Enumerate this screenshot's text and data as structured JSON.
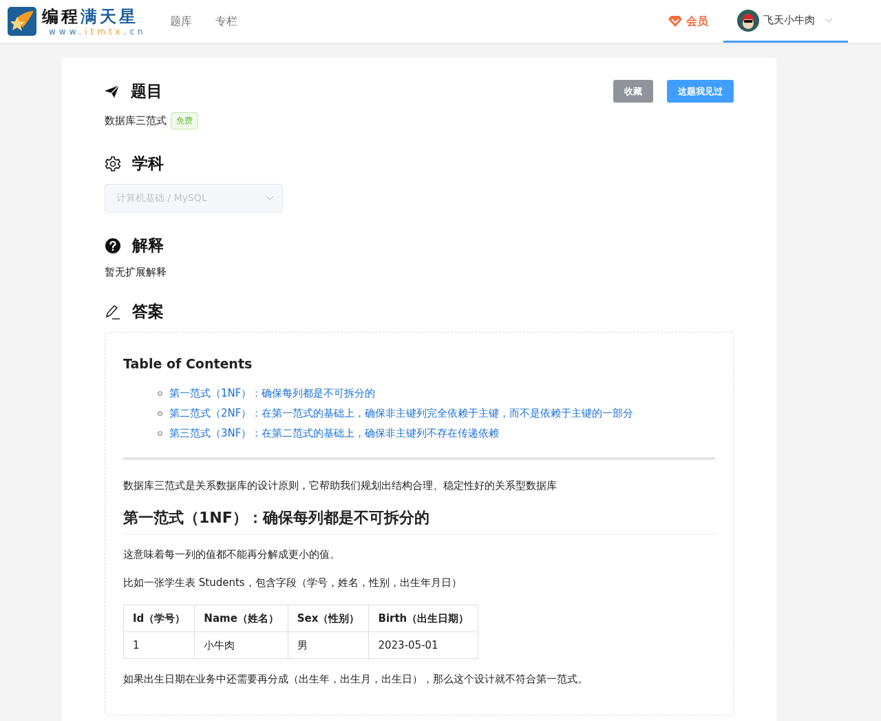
{
  "header": {
    "logo": {
      "title_parts": [
        "编程",
        "满天星"
      ],
      "url_parts": [
        "www.",
        "itmtx",
        ".cn"
      ]
    },
    "nav": [
      {
        "label": "题库",
        "selected": false
      },
      {
        "label": "专栏",
        "selected": false
      }
    ],
    "vip": {
      "label": "会员"
    },
    "user": {
      "name": "飞天小牛肉",
      "selected": true
    }
  },
  "question": {
    "heading": "题目",
    "title": "数据库三范式",
    "tag": "免费",
    "buttons": [
      {
        "label": "收藏",
        "kind": "secondary"
      },
      {
        "label": "这题我见过",
        "kind": "primary"
      }
    ]
  },
  "subject": {
    "heading": "学科",
    "select": {
      "value": "计算机基础 / MySQL",
      "disabled": true
    }
  },
  "explanation": {
    "heading": "解释",
    "text": "暂无扩展解释"
  },
  "answer": {
    "heading": "答案",
    "toc_title": "Table of Contents",
    "toc": [
      "第一范式（1NF）：确保每列都是不可拆分的",
      "第二范式（2NF）：在第一范式的基础上，确保非主键列完全依赖于主键，而不是依赖于主键的一部分",
      "第三范式（3NF）：在第二范式的基础上，确保非主键列不存在传递依赖"
    ],
    "intro": "数据库三范式是关系数据库的设计原则，它帮助我们规划出结构合理、稳定性好的关系型数据库",
    "section_title": "第一范式（1NF）：确保每列都是不可拆分的",
    "paragraphs": [
      "这意味着每一列的值都不能再分解成更小的值。",
      "比如一张学生表 Students，包含字段（学号，姓名，性别，出生年月日）"
    ],
    "table": {
      "columns": [
        "Id（学号）",
        "Name（姓名）",
        "Sex（性别）",
        "Birth（出生日期）"
      ],
      "rows": [
        [
          "1",
          "小牛肉",
          "男",
          "2023-05-01"
        ]
      ]
    },
    "closing": "如果出生日期在业务中还需要再分成（出生年，出生月，出生日），那么这个设计就不符合第一范式。"
  }
}
